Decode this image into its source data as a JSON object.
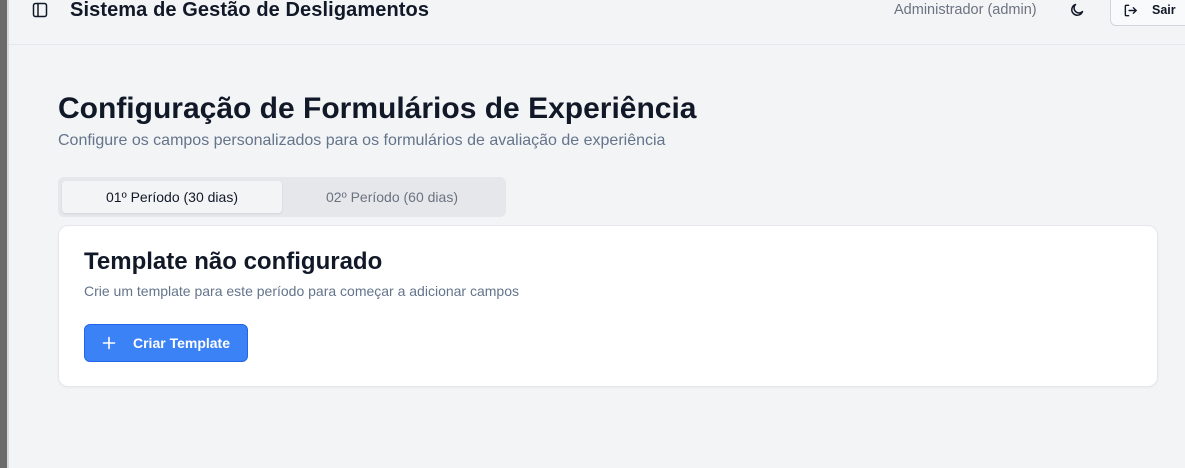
{
  "header": {
    "title": "Sistema de Gestão de Desligamentos",
    "user": "Administrador (admin)",
    "logout_label": "Sair",
    "icons": {
      "sidebar_toggle": "panel-left-icon",
      "theme_toggle": "moon-icon",
      "logout": "log-out-icon"
    }
  },
  "main": {
    "title": "Configuração de Formulários de Experiência",
    "subtitle": "Configure os campos personalizados para os formulários de avaliação de experiência",
    "tabs": [
      {
        "label": "01º Período (30 dias)",
        "active": true
      },
      {
        "label": "02º Período (60 dias)",
        "active": false
      }
    ],
    "card": {
      "title": "Template não configurado",
      "description": "Crie um template para este período para começar a adicionar campos",
      "create_button_label": "Criar Template",
      "create_icon": "plus-icon"
    }
  },
  "colors": {
    "primary": "#3b82f6",
    "background": "#f3f4f6",
    "card": "#ffffff",
    "muted_text": "#64748b"
  }
}
